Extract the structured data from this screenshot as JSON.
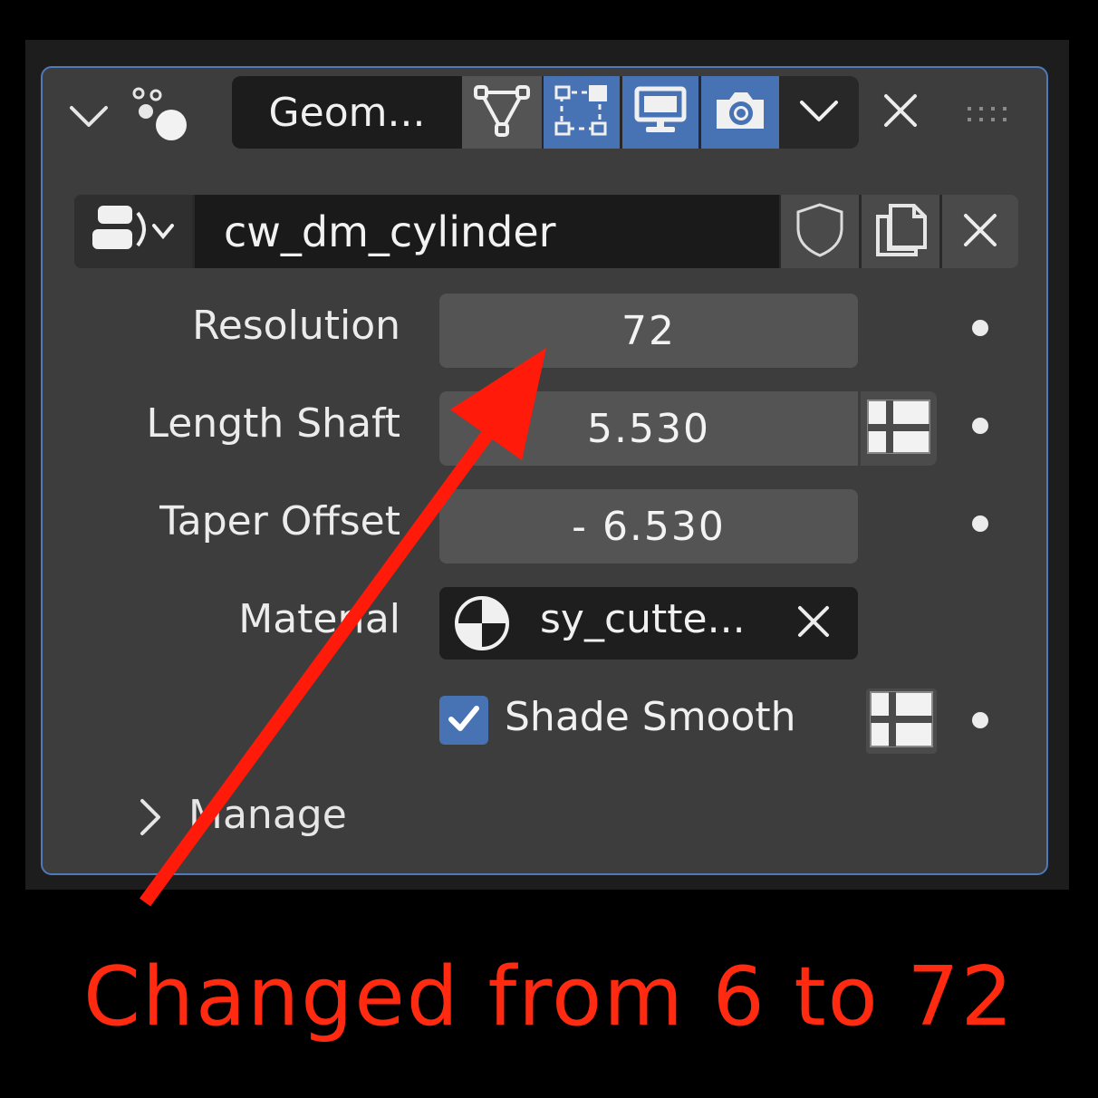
{
  "header": {
    "modifier_name": "Geom...",
    "icons": [
      "collapse-chevron-icon",
      "geometry-nodes-icon",
      "node-tree-icon",
      "edit-mode-icon",
      "viewport-display-icon",
      "render-icon",
      "dropdown-chevron-icon",
      "close-icon",
      "drag-handle-icon"
    ]
  },
  "datablock": {
    "name": "cw_dm_cylinder",
    "icons": [
      "node-group-browse-icon",
      "fake-user-shield-icon",
      "duplicate-icon",
      "unlink-icon"
    ]
  },
  "properties": [
    {
      "label": "Resolution",
      "value": "72"
    },
    {
      "label": "Length Shaft",
      "value": "5.530"
    },
    {
      "label": "Taper Offset",
      "value": "- 6.530"
    },
    {
      "label": "Material",
      "value": "sy_cutte..."
    }
  ],
  "shade_smooth": {
    "label": "Shade Smooth",
    "checked": true
  },
  "manage": {
    "label": "Manage"
  },
  "annotation": {
    "caption": "Changed from 6 to 72",
    "color": "#ff2a10"
  },
  "colors": {
    "accent": "#4772b3",
    "panel_border": "#4f79b8",
    "panel_bg": "#3d3d3d"
  }
}
